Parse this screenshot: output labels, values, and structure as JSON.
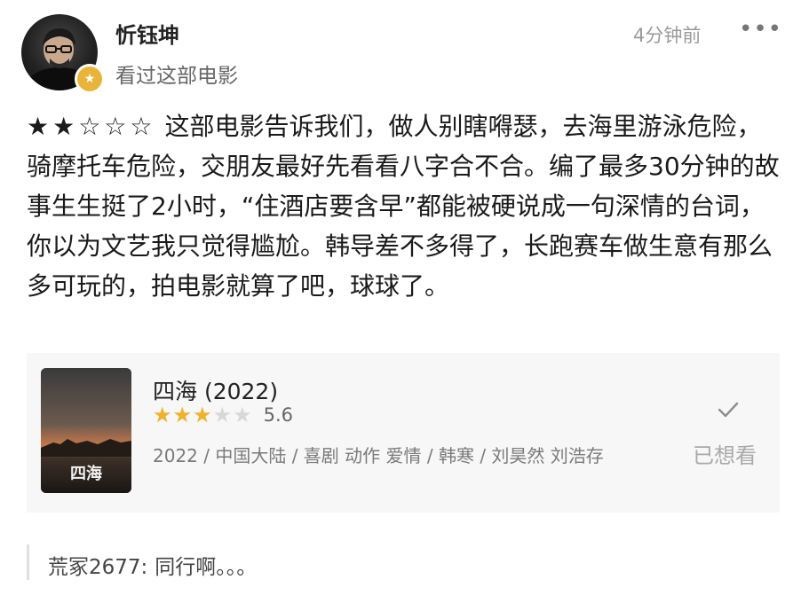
{
  "post": {
    "username": "忻钰坤",
    "status": "看过这部电影",
    "time": "4分钟前",
    "more_icon": "more-dots-icon",
    "review_stars": "★★☆☆☆",
    "review_rating_given": 2,
    "review_text": "这部电影告诉我们，做人别瞎嘚瑟，去海里游泳危险，骑摩托车危险，交朋友最好先看看八字合不合。编了最多30分钟的故事生生挺了2小时，“住酒店要含早”都能被硬说成一句深情的台词，你以为文艺我只觉得尴尬。韩导差不多得了，长跑赛车做生意有那么多可玩的，拍电影就算了吧，球球了。"
  },
  "movie": {
    "title": "四海 (2022)",
    "rating_stars": "★★★★★",
    "rating_fill": 0.6,
    "score": "5.6",
    "meta": "2022 / 中国大陆 / 喜剧 动作 爱情 / 韩寒 / 刘昊然 刘浩存",
    "wish_status": "已想看",
    "poster_text": "四海",
    "check_icon": "check-icon"
  },
  "comment": {
    "author": "荒冢2677:",
    "text": "同行啊。。。"
  },
  "colors": {
    "star_gold": "#f0b22c",
    "vip_badge": "#e8b53a",
    "card_bg": "#f7f7f7"
  }
}
